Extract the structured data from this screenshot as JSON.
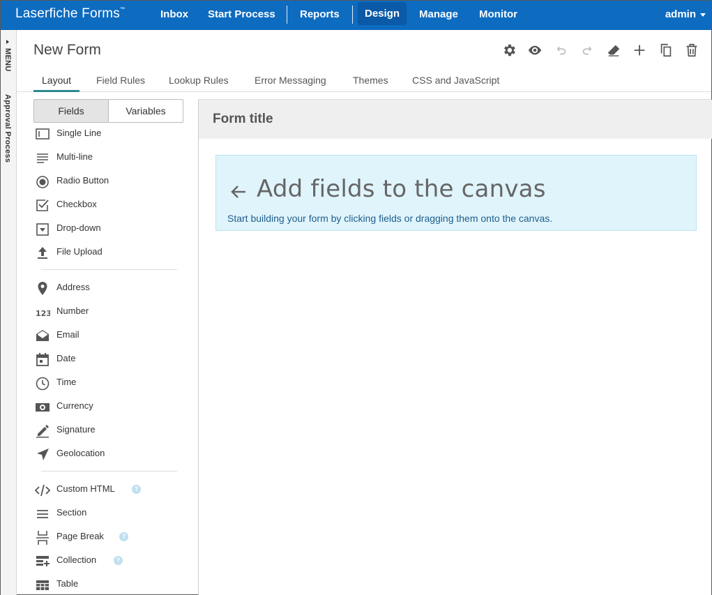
{
  "nav": {
    "brand": "Laserfiche Forms",
    "brand_tm": "™",
    "items": [
      "Inbox",
      "Start Process",
      "Reports",
      "Design",
      "Manage",
      "Monitor"
    ],
    "user": "admin"
  },
  "sidestrip": {
    "menu": "MENU",
    "process": "Approval Process"
  },
  "header": {
    "title": "New Form"
  },
  "toolbar": {
    "icons": [
      "gear-icon",
      "eye-icon",
      "undo-icon",
      "redo-icon",
      "eraser-icon",
      "plus-icon",
      "copy-icon",
      "trash-icon"
    ]
  },
  "tabs": [
    "Layout",
    "Field Rules",
    "Lookup Rules",
    "Error Messaging",
    "Themes",
    "CSS and JavaScript"
  ],
  "panel": {
    "toggle": [
      "Fields",
      "Variables"
    ],
    "fields": [
      {
        "label": "Single Line",
        "icon": "single-line-icon"
      },
      {
        "label": "Multi-line",
        "icon": "multi-line-icon"
      },
      {
        "label": "Radio Button",
        "icon": "radio-icon"
      },
      {
        "label": "Checkbox",
        "icon": "checkbox-icon"
      },
      {
        "label": "Drop-down",
        "icon": "dropdown-icon"
      },
      {
        "label": "File Upload",
        "icon": "upload-icon"
      },
      {
        "label": "Address",
        "icon": "map-pin-icon"
      },
      {
        "label": "Number",
        "icon": "number-icon"
      },
      {
        "label": "Email",
        "icon": "email-icon"
      },
      {
        "label": "Date",
        "icon": "calendar-icon"
      },
      {
        "label": "Time",
        "icon": "clock-icon"
      },
      {
        "label": "Currency",
        "icon": "currency-icon"
      },
      {
        "label": "Signature",
        "icon": "pen-icon"
      },
      {
        "label": "Geolocation",
        "icon": "location-arrow-icon"
      },
      {
        "label": "Custom HTML",
        "icon": "code-icon"
      },
      {
        "label": "Section",
        "icon": "section-icon"
      },
      {
        "label": "Page Break",
        "icon": "page-break-icon"
      },
      {
        "label": "Collection",
        "icon": "collection-icon"
      },
      {
        "label": "Table",
        "icon": "table-icon"
      }
    ]
  },
  "canvas": {
    "form_title": "Form title",
    "hint_title": "Add fields to the canvas",
    "hint_sub": "Start building your form by clicking fields or dragging them onto the canvas."
  },
  "colors": {
    "nav": "#0d6bc0",
    "tab_active": "#2b8a8f",
    "hint_bg": "#e0f4fb"
  }
}
